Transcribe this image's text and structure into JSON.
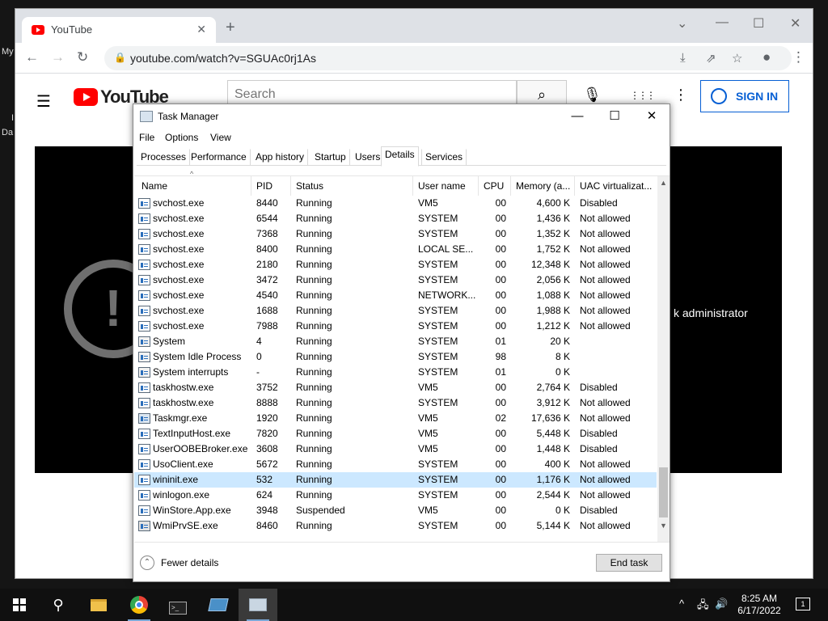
{
  "desktop": {
    "labels": [
      "My",
      "I",
      "Da"
    ]
  },
  "browser": {
    "tab_title": "YouTube",
    "tab_close": "✕",
    "new_tab": "+",
    "window_controls": {
      "dropdown": "⌄",
      "minimize": "—",
      "maximize": "☐",
      "close": "✕"
    },
    "nav": {
      "back": "←",
      "forward": "→",
      "reload": "↻"
    },
    "url": "youtube.com/watch?v=SGUAc0rj1As",
    "lock": "🔒",
    "omni_icons": {
      "install": "⤓",
      "share": "⇗",
      "bookmark": "☆",
      "profile": "●",
      "menu": "⋮"
    }
  },
  "youtube": {
    "menu_icon": "☰",
    "logo_text": "YouTube",
    "search_placeholder": "Search",
    "search_icon": "⌕",
    "mic_icon": "🎙",
    "apps_icon": "⋮⋮⋮",
    "more_icon": "⋮",
    "signin_label": "SIGN IN",
    "error_icon": "!",
    "error_text": "k administrator"
  },
  "task_manager": {
    "title": "Task Manager",
    "controls": {
      "minimize": "—",
      "maximize": "☐",
      "close": "✕"
    },
    "menu": [
      "File",
      "Options",
      "View"
    ],
    "tabs": [
      "Processes",
      "Performance",
      "App history",
      "Startup",
      "Users",
      "Details",
      "Services"
    ],
    "active_tab": "Details",
    "columns": [
      "Name",
      "PID",
      "Status",
      "User name",
      "CPU",
      "Memory (a...",
      "UAC virtualizat..."
    ],
    "sort_caret": "^",
    "rows": [
      {
        "name": "svchost.exe",
        "pid": "8440",
        "status": "Running",
        "user": "VM5",
        "cpu": "00",
        "memory": "4,600 K",
        "uac": "Disabled",
        "icon": "svc"
      },
      {
        "name": "svchost.exe",
        "pid": "6544",
        "status": "Running",
        "user": "SYSTEM",
        "cpu": "00",
        "memory": "1,436 K",
        "uac": "Not allowed",
        "icon": "svc"
      },
      {
        "name": "svchost.exe",
        "pid": "7368",
        "status": "Running",
        "user": "SYSTEM",
        "cpu": "00",
        "memory": "1,352 K",
        "uac": "Not allowed",
        "icon": "svc"
      },
      {
        "name": "svchost.exe",
        "pid": "8400",
        "status": "Running",
        "user": "LOCAL SE...",
        "cpu": "00",
        "memory": "1,752 K",
        "uac": "Not allowed",
        "icon": "svc"
      },
      {
        "name": "svchost.exe",
        "pid": "2180",
        "status": "Running",
        "user": "SYSTEM",
        "cpu": "00",
        "memory": "12,348 K",
        "uac": "Not allowed",
        "icon": "svc"
      },
      {
        "name": "svchost.exe",
        "pid": "3472",
        "status": "Running",
        "user": "SYSTEM",
        "cpu": "00",
        "memory": "2,056 K",
        "uac": "Not allowed",
        "icon": "svc"
      },
      {
        "name": "svchost.exe",
        "pid": "4540",
        "status": "Running",
        "user": "NETWORK...",
        "cpu": "00",
        "memory": "1,088 K",
        "uac": "Not allowed",
        "icon": "svc"
      },
      {
        "name": "svchost.exe",
        "pid": "1688",
        "status": "Running",
        "user": "SYSTEM",
        "cpu": "00",
        "memory": "1,988 K",
        "uac": "Not allowed",
        "icon": "svc"
      },
      {
        "name": "svchost.exe",
        "pid": "7988",
        "status": "Running",
        "user": "SYSTEM",
        "cpu": "00",
        "memory": "1,212 K",
        "uac": "Not allowed",
        "icon": "svc"
      },
      {
        "name": "System",
        "pid": "4",
        "status": "Running",
        "user": "SYSTEM",
        "cpu": "01",
        "memory": "20 K",
        "uac": "",
        "icon": "sys"
      },
      {
        "name": "System Idle Process",
        "pid": "0",
        "status": "Running",
        "user": "SYSTEM",
        "cpu": "98",
        "memory": "8 K",
        "uac": "",
        "icon": "sys"
      },
      {
        "name": "System interrupts",
        "pid": "-",
        "status": "Running",
        "user": "SYSTEM",
        "cpu": "01",
        "memory": "0 K",
        "uac": "",
        "icon": "sys"
      },
      {
        "name": "taskhostw.exe",
        "pid": "3752",
        "status": "Running",
        "user": "VM5",
        "cpu": "00",
        "memory": "2,764 K",
        "uac": "Disabled",
        "icon": "svc"
      },
      {
        "name": "taskhostw.exe",
        "pid": "8888",
        "status": "Running",
        "user": "SYSTEM",
        "cpu": "00",
        "memory": "3,912 K",
        "uac": "Not allowed",
        "icon": "svc"
      },
      {
        "name": "Taskmgr.exe",
        "pid": "1920",
        "status": "Running",
        "user": "VM5",
        "cpu": "02",
        "memory": "17,636 K",
        "uac": "Not allowed",
        "icon": "tm"
      },
      {
        "name": "TextInputHost.exe",
        "pid": "7820",
        "status": "Running",
        "user": "VM5",
        "cpu": "00",
        "memory": "5,448 K",
        "uac": "Disabled",
        "icon": "svc"
      },
      {
        "name": "UserOOBEBroker.exe",
        "pid": "3608",
        "status": "Running",
        "user": "VM5",
        "cpu": "00",
        "memory": "1,448 K",
        "uac": "Disabled",
        "icon": "svc"
      },
      {
        "name": "UsoClient.exe",
        "pid": "5672",
        "status": "Running",
        "user": "SYSTEM",
        "cpu": "00",
        "memory": "400 K",
        "uac": "Not allowed",
        "icon": "svc"
      },
      {
        "name": "wininit.exe",
        "pid": "532",
        "status": "Running",
        "user": "SYSTEM",
        "cpu": "00",
        "memory": "1,176 K",
        "uac": "Not allowed",
        "icon": "svc",
        "selected": true
      },
      {
        "name": "winlogon.exe",
        "pid": "624",
        "status": "Running",
        "user": "SYSTEM",
        "cpu": "00",
        "memory": "2,544 K",
        "uac": "Not allowed",
        "icon": "svc"
      },
      {
        "name": "WinStore.App.exe",
        "pid": "3948",
        "status": "Suspended",
        "user": "VM5",
        "cpu": "00",
        "memory": "0 K",
        "uac": "Disabled",
        "icon": "svc"
      },
      {
        "name": "WmiPrvSE.exe",
        "pid": "8460",
        "status": "Running",
        "user": "SYSTEM",
        "cpu": "00",
        "memory": "5,144 K",
        "uac": "Not allowed",
        "icon": "wmi"
      }
    ],
    "scroll": {
      "up": "▲",
      "down": "▼"
    },
    "fewer_details_icon": "⌃",
    "fewer_details": "Fewer details",
    "end_task": "End task"
  },
  "taskbar": {
    "icons": [
      "search-icon",
      "file-explorer-icon",
      "chrome-icon",
      "terminal-icon",
      "app-icon",
      "task-manager-icon"
    ],
    "search_glyph": "⚲",
    "tray": {
      "chevron": "^",
      "network": "🖧",
      "volume": "🔊"
    },
    "time": "8:25 AM",
    "date": "6/17/2022",
    "notifications": "1"
  }
}
